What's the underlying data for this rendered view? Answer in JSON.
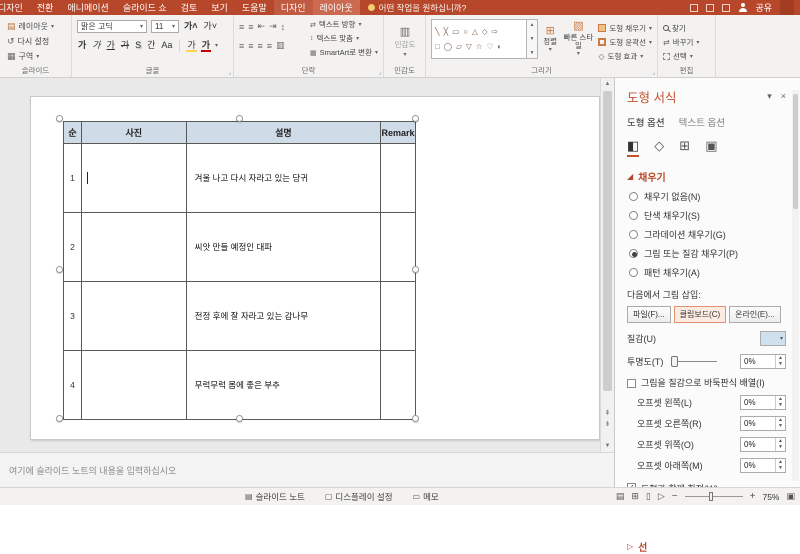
{
  "titlebar": {
    "tabs": [
      "디자인",
      "전환",
      "애니메이션",
      "슬라이드 쇼",
      "검토",
      "보기",
      "도움말",
      "디자인",
      "레이아웃"
    ],
    "search_placeholder": "어떤 작업을 원하십니까?",
    "share_label": "공유"
  },
  "ribbon": {
    "slides": {
      "label": "슬라이드",
      "layout": "레이아웃",
      "reset": "다시 설정",
      "section": "구역"
    },
    "font": {
      "label": "글꼴",
      "font_name": "맑은 고딕",
      "font_size": "11"
    },
    "paragraph": {
      "label": "단락",
      "text_direction": "텍스트 방향",
      "text_align": "텍스트 맞춤",
      "smartart": "SmartArt로 변환"
    },
    "sensitivity": {
      "label": "민감도",
      "button": "민감도"
    },
    "drawing": {
      "label": "그리기",
      "arrange": "정렬",
      "quick_styles": "빠른 스타일",
      "shape_fill": "도형 채우기",
      "shape_outline": "도형 윤곽선",
      "shape_effects": "도형 효과",
      "gallery_row1": "╲ ╳ ▭ ○ △ ◇ ⇨",
      "gallery_row2": "□ ◯ ▱ ▽ ☆ ♡ ◐"
    },
    "editing": {
      "label": "편집",
      "find": "찾기",
      "replace": "바꾸기",
      "select": "선택"
    }
  },
  "slide": {
    "table": {
      "headers": [
        "순",
        "사진",
        "설명",
        "Remark"
      ],
      "rows": [
        {
          "no": "1",
          "photo": "",
          "desc": "겨울 나고 다시 자라고 있는 당귀",
          "remark": ""
        },
        {
          "no": "2",
          "photo": "",
          "desc": "씨앗 만들 예정인 대파",
          "remark": ""
        },
        {
          "no": "3",
          "photo": "",
          "desc": "전정 후에 잘 자라고 있는 감나무",
          "remark": ""
        },
        {
          "no": "4",
          "photo": "",
          "desc": "무럭무럭 몸에 좋은 부추",
          "remark": ""
        }
      ]
    }
  },
  "notes": {
    "placeholder": "여기에 슬라이드 노트의 내용을 입력하십시오"
  },
  "format_pane": {
    "title": "도형 서식",
    "tab_shape": "도형 옵션",
    "tab_text": "텍스트 옵션",
    "fill": {
      "header": "채우기",
      "options": [
        "채우기 없음(N)",
        "단색 채우기(S)",
        "그라데이션 채우기(G)",
        "그림 또는 질감 채우기(P)",
        "패턴 채우기(A)"
      ],
      "selected": "그림 또는 질감 채우기(P)",
      "insert_label": "다음에서 그림 삽입:",
      "file_button": "파일(F)...",
      "clipboard_button": "클립보드(C)",
      "online_button": "온라인(E)...",
      "texture_label": "질감(U)",
      "transparency_label": "투명도(T)",
      "transparency_value": "0%",
      "tile_label": "그림을 질감으로 바둑판식 배열(I)",
      "offset_left": {
        "label": "오프셋 왼쪽(L)",
        "value": "0%"
      },
      "offset_right": {
        "label": "오프셋 오른쪽(R)",
        "value": "0%"
      },
      "offset_top": {
        "label": "오프셋 위쪽(O)",
        "value": "0%"
      },
      "offset_bottom": {
        "label": "오프셋 아래쪽(M)",
        "value": "0%"
      },
      "rotate_label": "도형과 함께 회전(W)"
    },
    "line_header": "선"
  },
  "statusbar": {
    "notes_toggle": "슬라이드 노트",
    "display_settings": "디스플레이 설정",
    "memo": "메모",
    "zoom_level": "75%"
  },
  "colors": {
    "accent": "#b7472a",
    "table_header": "#cfdce8"
  }
}
